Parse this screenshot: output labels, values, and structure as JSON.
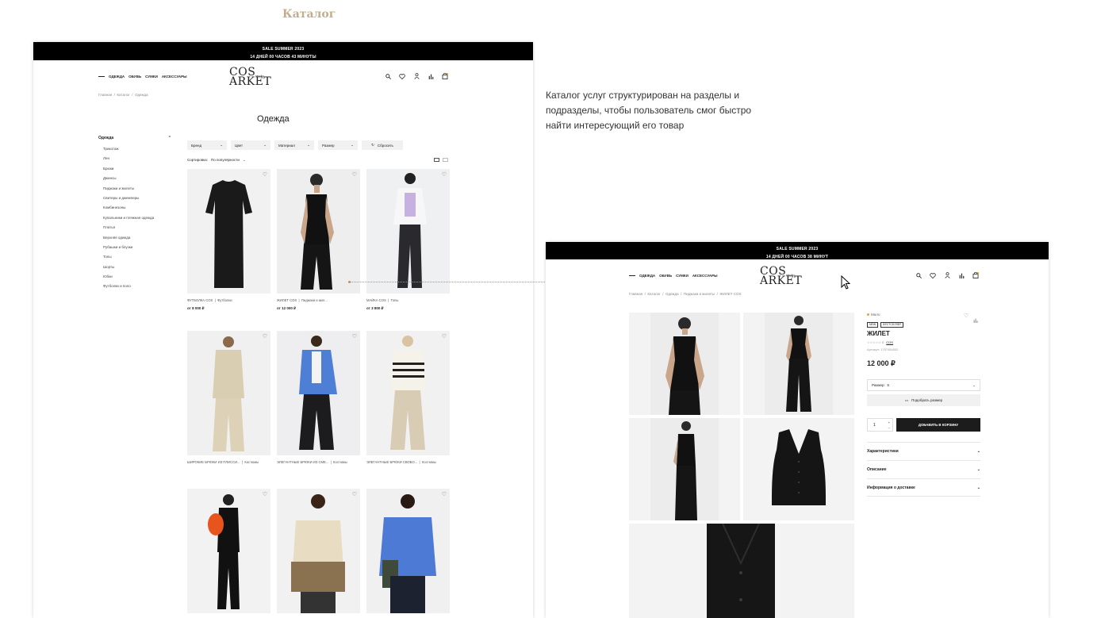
{
  "heading": "Каталог",
  "description": "Каталог услуг структурирован на разделы и подразделы, чтобы пользователь смог быстро найти интересующий его товар",
  "banner": {
    "line1": "SALE SUMMER 2023",
    "line2": "14 ДНЕЙ 00 ЧАСОВ 43 МИНУТЫ"
  },
  "banner_product": {
    "line1": "SALE SUMMER 2023",
    "line2": "14 ДНЕЙ 00 ЧАСОВ 38 МИНУТ"
  },
  "nav": [
    "ОДЕЖДА",
    "ОБУВЬ",
    "СУМКИ",
    "АКСЕССУАРЫ"
  ],
  "logo": {
    "line1": "COS",
    "line2": "ARKET",
    "studio": "studio"
  },
  "icons": [
    "search-icon",
    "heart-icon",
    "user-icon",
    "compare-icon",
    "cart-icon"
  ],
  "catalog": {
    "breadcrumbs": [
      "Главная",
      "Каталог",
      "Одежда"
    ],
    "title": "Одежда",
    "sidebar": {
      "heading": "Одежда",
      "items": [
        "Трикотаж",
        "Лен",
        "Брюки",
        "Джинсы",
        "Пиджаки и жилеты",
        "Свитеры и джемперы",
        "Комбинезоны",
        "Купальники и пляжная одежда",
        "Платья",
        "Верхняя одежда",
        "Рубашки и блузки",
        "Топы",
        "Шорты",
        "Юбки",
        "Футболки и поло"
      ]
    },
    "filters": [
      "Бренд",
      "Цвет",
      "Материал",
      "Размер"
    ],
    "reset": "Сбросить",
    "sort_label": "Сортировка:",
    "sort_value": "По популярности",
    "products": [
      {
        "name": "ФУТБОЛКА COS",
        "category": "Футболки",
        "price": "от 8 000 ₽",
        "bg": "#f1f1f1"
      },
      {
        "name": "ЖИЛЕТ COS",
        "category": "Пиджаки и жил...",
        "price": "от 12 000 ₽",
        "bg": "#eeeeee"
      },
      {
        "name": "МАЙКА COS",
        "category": "Топы",
        "price": "от 3 800 ₽",
        "bg": "#eff0f2"
      },
      {
        "name": "ШИРОКИЕ БРЮКИ ИЗ ПЛИССИ...",
        "category": "Костюмы",
        "price": "",
        "bg": "#f0f0f0"
      },
      {
        "name": "ЭЛЕГАНТНЫЕ БРЮКИ ИЗ СМЕ...",
        "category": "Костюмы",
        "price": "",
        "bg": "#eeeef0"
      },
      {
        "name": "ЭЛЕГАНТНЫЕ БРЮКИ СВОБО...",
        "category": "Костюмы",
        "price": "",
        "bg": "#f1f1f1"
      },
      {
        "name": "",
        "category": "",
        "price": "",
        "bg": "#f2f2f2"
      },
      {
        "name": "",
        "category": "",
        "price": "",
        "bg": "#f1f1f1"
      },
      {
        "name": "",
        "category": "",
        "price": "",
        "bg": "#f0f0f0"
      }
    ]
  },
  "product_page": {
    "breadcrumbs": [
      "Главная",
      "Каталог",
      "Одежда",
      "Пиджаки и жилеты",
      "ЖИЛЕТ COS"
    ],
    "stock": "Мало",
    "badges": [
      "NEW",
      "БЕСТСЕЛЛЕР"
    ],
    "title": "ЖИЛЕТ",
    "rating": "☆☆☆☆☆ 0",
    "brand": "COS",
    "article": "Артикул: 1757454002",
    "price": "12 000 ₽",
    "size_label": "Размер:",
    "size_value": "S",
    "fit_button": "Подобрать размер",
    "quantity": "1",
    "add_to_cart": "ДОБАВИТЬ В КОРЗИНУ",
    "accordion": [
      "Характеристики",
      "Описание",
      "Информация о доставке"
    ]
  }
}
